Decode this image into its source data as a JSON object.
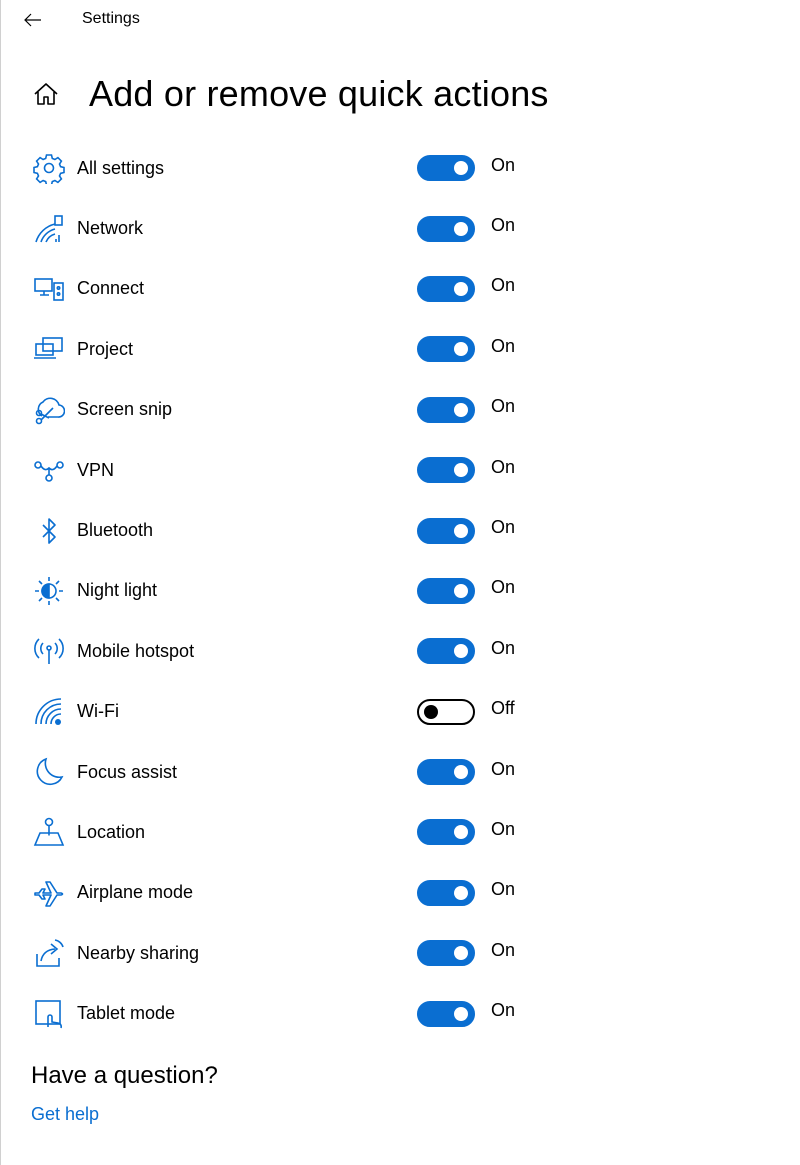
{
  "window": {
    "app_title": "Settings",
    "back_icon": "back-arrow-icon",
    "home_icon": "home-icon"
  },
  "page": {
    "title": "Add or remove quick actions"
  },
  "colors": {
    "accent": "#0a6ed1",
    "text": "#000000",
    "background": "#ffffff"
  },
  "quick_actions": [
    {
      "label": "All settings",
      "icon": "gear-icon",
      "on": true,
      "state": "On"
    },
    {
      "label": "Network",
      "icon": "network-icon",
      "on": true,
      "state": "On"
    },
    {
      "label": "Connect",
      "icon": "connect-icon",
      "on": true,
      "state": "On"
    },
    {
      "label": "Project",
      "icon": "project-icon",
      "on": true,
      "state": "On"
    },
    {
      "label": "Screen snip",
      "icon": "screen-snip-icon",
      "on": true,
      "state": "On"
    },
    {
      "label": "VPN",
      "icon": "vpn-icon",
      "on": true,
      "state": "On"
    },
    {
      "label": "Bluetooth",
      "icon": "bluetooth-icon",
      "on": true,
      "state": "On"
    },
    {
      "label": "Night light",
      "icon": "night-light-icon",
      "on": true,
      "state": "On"
    },
    {
      "label": "Mobile hotspot",
      "icon": "mobile-hotspot-icon",
      "on": true,
      "state": "On"
    },
    {
      "label": "Wi-Fi",
      "icon": "wifi-icon",
      "on": false,
      "state": "Off"
    },
    {
      "label": "Focus assist",
      "icon": "moon-icon",
      "on": true,
      "state": "On"
    },
    {
      "label": "Location",
      "icon": "location-icon",
      "on": true,
      "state": "On"
    },
    {
      "label": "Airplane mode",
      "icon": "airplane-icon",
      "on": true,
      "state": "On"
    },
    {
      "label": "Nearby sharing",
      "icon": "nearby-sharing-icon",
      "on": true,
      "state": "On"
    },
    {
      "label": "Tablet mode",
      "icon": "tablet-mode-icon",
      "on": true,
      "state": "On"
    }
  ],
  "footer": {
    "question": "Have a question?",
    "help_link": "Get help"
  }
}
